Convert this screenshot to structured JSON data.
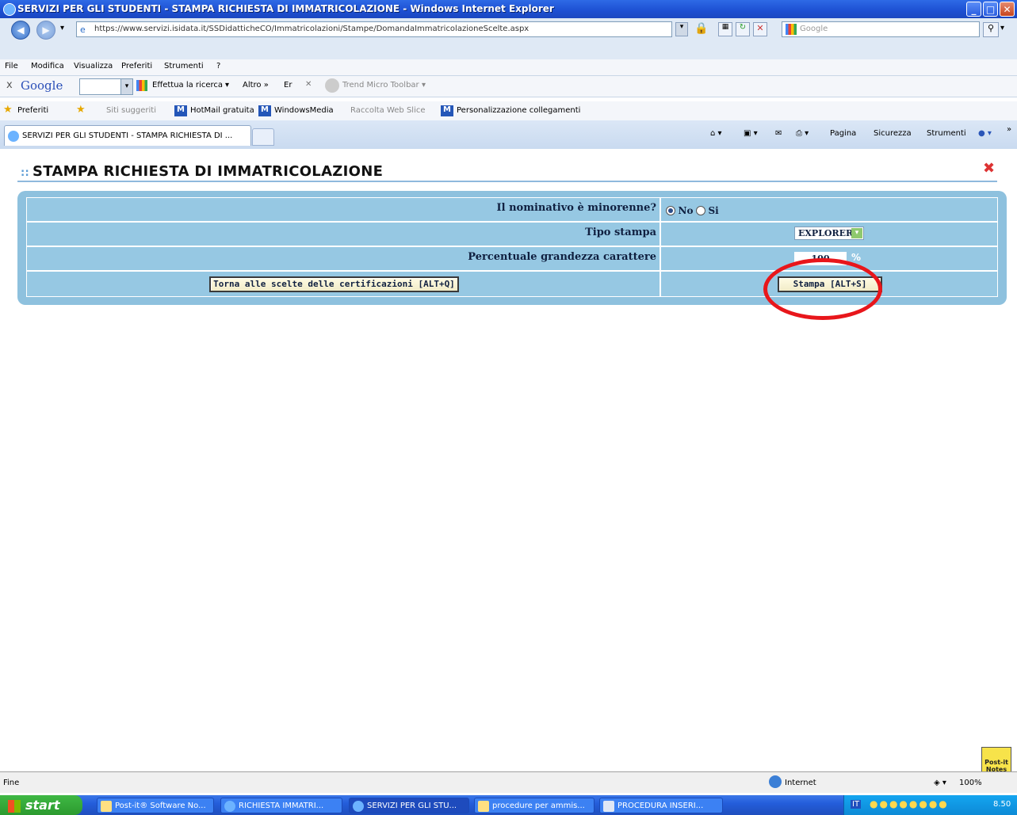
{
  "window": {
    "title": "SERVIZI PER GLI STUDENTI - STAMPA RICHIESTA DI IMMATRICOLAZIONE - Windows Internet Explorer"
  },
  "address_bar": {
    "url": "https://www.servizi.isidata.it/SSDidatticheCO/Immatricolazioni/Stampe/DomandaImmatricolazioneScelte.aspx",
    "search_placeholder": "Google"
  },
  "menu": [
    "File",
    "Modifica",
    "Visualizza",
    "Preferiti",
    "Strumenti",
    "?"
  ],
  "google_toolbar": {
    "close": "x",
    "logo": "Google",
    "search_label": "Effettua la ricerca",
    "more": "Altro »",
    "er": "Er",
    "trend": "Trend Micro Toolbar"
  },
  "favorites_bar": {
    "preferiti": "Preferiti",
    "items": [
      "Siti suggeriti",
      "HotMail gratuita",
      "WindowsMedia",
      "Raccolta Web Slice",
      "Personalizzazione collegamenti"
    ]
  },
  "tab": {
    "label": "SERVIZI PER GLI STUDENTI - STAMPA RICHIESTA DI ..."
  },
  "command_bar": {
    "pagina": "Pagina",
    "sicurezza": "Sicurezza",
    "strumenti": "Strumenti"
  },
  "page": {
    "title": "STAMPA RICHIESTA DI IMMATRICOLAZIONE",
    "rows": {
      "minorenne_label": "Il nominativo è minorenne?",
      "radio_no": "No",
      "radio_si": "Si",
      "tipo_label": "Tipo stampa",
      "tipo_value": "EXPLORER",
      "perc_label": "Percentuale grandezza carattere",
      "perc_value": "100",
      "perc_unit": "%",
      "back_button": "Torna alle scelte delle certificazioni [ALT+Q]",
      "print_button": "Stampa [ALT+S]"
    },
    "selected_minorenne": "No"
  },
  "status_bar": {
    "text": "Fine",
    "zone": "Internet",
    "zoom": "100%"
  },
  "postit": {
    "line1": "Post-it",
    "line2": "Notes"
  },
  "taskbar": {
    "start": "start",
    "tasks": [
      "Post-it® Software No...",
      "RICHIESTA IMMATRI...",
      "SERVIZI PER GLI STU...",
      "procedure per ammis...",
      "PROCEDURA INSERI..."
    ],
    "lang": "IT",
    "clock": "8.50"
  },
  "colors": {
    "titlebar": "#245edb",
    "panel": "#8ec1de",
    "highlight_ellipse": "#e8161b"
  }
}
